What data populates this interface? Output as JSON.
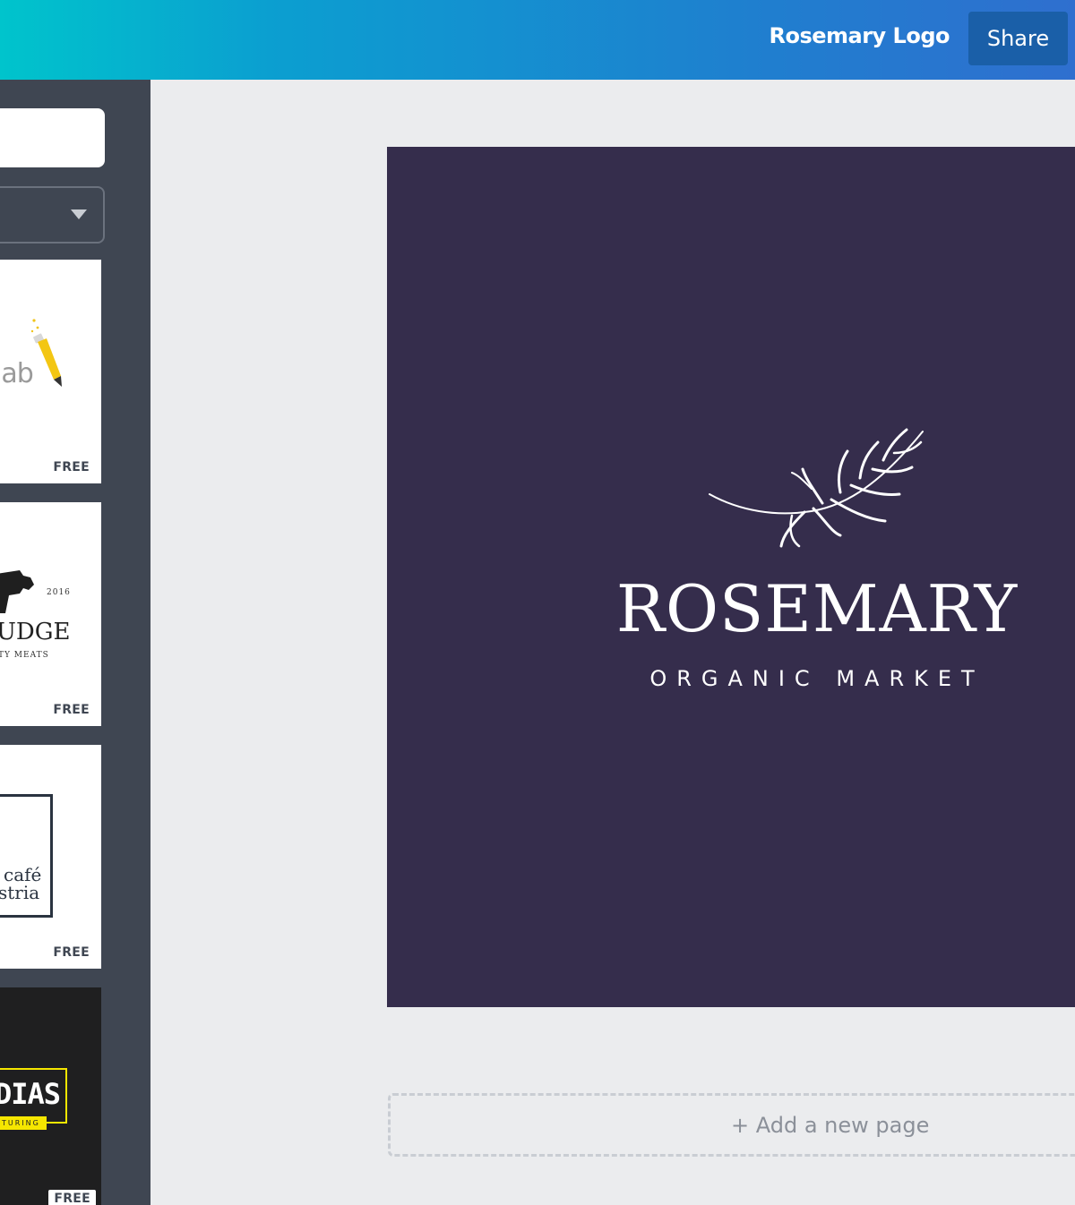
{
  "header": {
    "doc_title": "Rosemary Logo",
    "share_label": "Share"
  },
  "sidebar": {
    "templates": [
      {
        "text": "lab",
        "badge": "FREE"
      },
      {
        "text": "UDGE",
        "sub": "TY MEATS",
        "year": "2016",
        "badge": "FREE"
      },
      {
        "text1": "café",
        "text2": "stria",
        "badge": "FREE"
      },
      {
        "text": "DIAS",
        "sub": "TURING",
        "badge": "FREE"
      }
    ]
  },
  "canvas": {
    "background": "#352d4c",
    "brand_name": "ROSEMARY",
    "tagline": "ORGANIC MARKET"
  },
  "add_page_label": "+ Add a new page"
}
